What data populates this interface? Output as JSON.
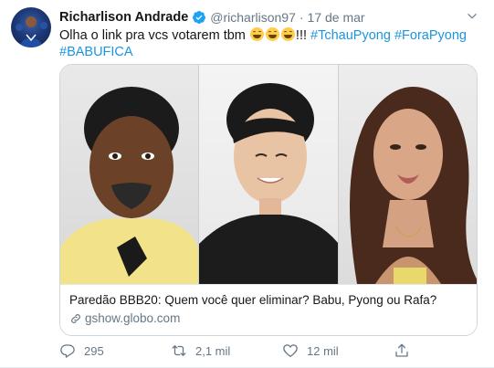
{
  "tweet": {
    "author_name": "Richarlison Andrade",
    "handle": "@richarlison97",
    "separator": "·",
    "date": "17 de mar",
    "text_prefix": "Olha o link pra vcs votarem tbm ",
    "text_suffix": "!!! ",
    "hashtags": [
      "#TchauPyong",
      "#ForaPyong",
      "#BABUFICA"
    ],
    "emoji_names": [
      "grinning-face-icon",
      "grinning-face-icon",
      "grinning-face-icon"
    ],
    "verified": true
  },
  "card": {
    "title": "Paredão BBB20: Quem você quer eliminar? Babu, Pyong ou Rafa?",
    "domain": "gshow.globo.com"
  },
  "actions": {
    "replies": "295",
    "retweets": "2,1 mil",
    "likes": "12 mil"
  },
  "colors": {
    "link_blue": "#1b95e0",
    "verified_blue": "#1da1f2",
    "muted_gray": "#657786",
    "text": "#14171a"
  },
  "icons": [
    "verified-badge-icon",
    "chevron-down-icon",
    "link-icon",
    "reply-icon",
    "retweet-icon",
    "like-icon",
    "share-icon"
  ]
}
